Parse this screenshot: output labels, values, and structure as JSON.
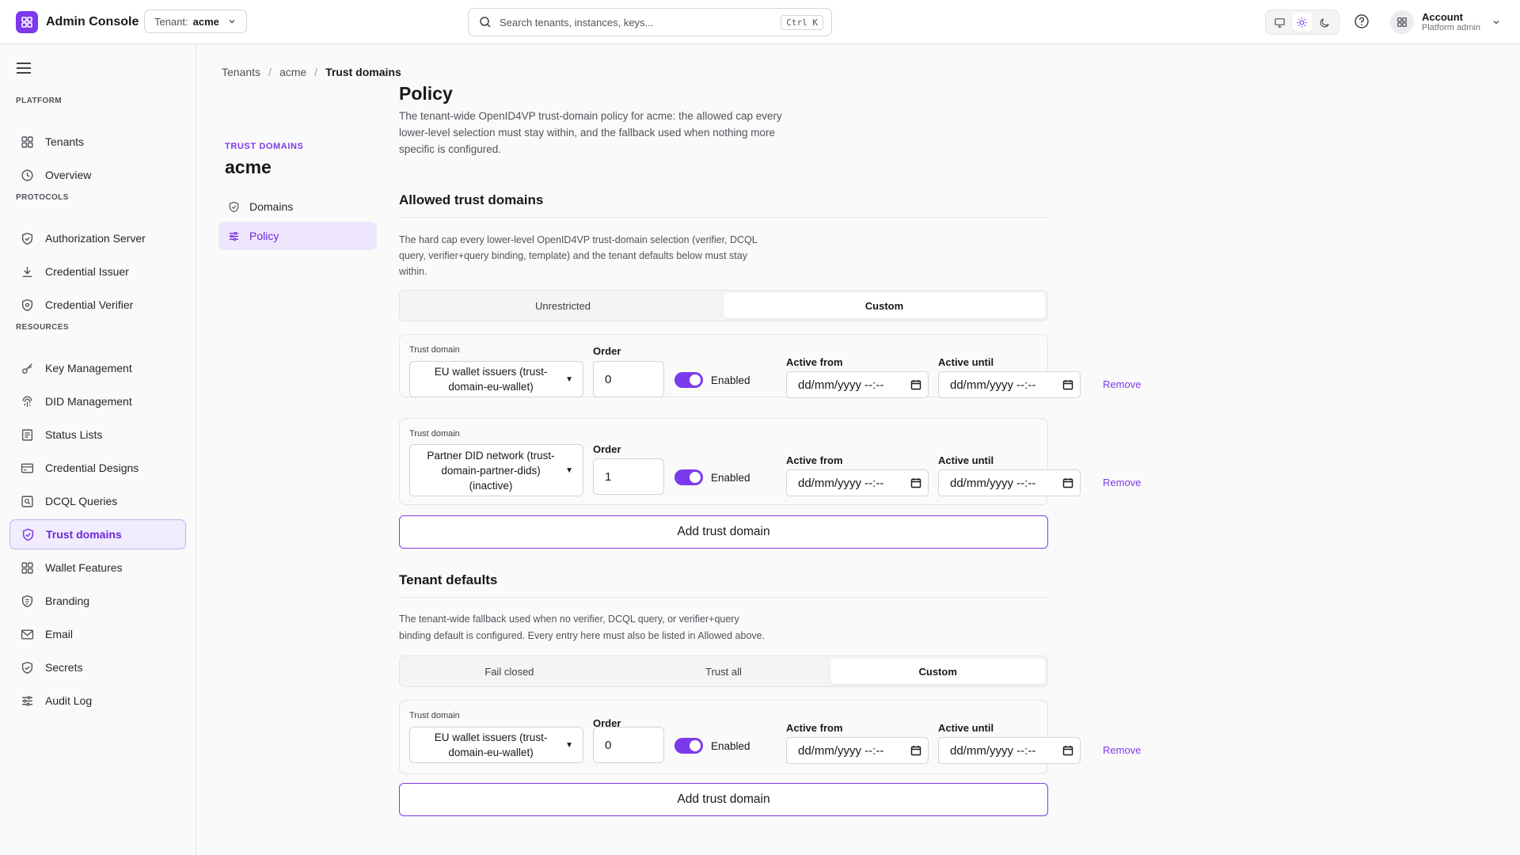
{
  "app": {
    "title": "Admin Console"
  },
  "tenant": {
    "label": "Tenant:",
    "value": "acme"
  },
  "search": {
    "placeholder": "Search tenants, instances, keys...",
    "shortcut": "Ctrl K"
  },
  "account": {
    "name": "Account",
    "role": "Platform admin"
  },
  "theme": {
    "selected": "light"
  },
  "sidebar": {
    "sections": [
      {
        "title": "PLATFORM",
        "items": [
          {
            "label": "Tenants",
            "icon": "grid-icon"
          },
          {
            "label": "Overview",
            "icon": "clock-icon"
          }
        ]
      },
      {
        "title": "PROTOCOLS",
        "items": [
          {
            "label": "Authorization Server",
            "icon": "shield-icon"
          },
          {
            "label": "Credential Issuer",
            "icon": "download-icon"
          },
          {
            "label": "Credential Verifier",
            "icon": "shield-check-icon"
          }
        ]
      },
      {
        "title": "RESOURCES",
        "items": [
          {
            "label": "Key Management",
            "icon": "key-icon"
          },
          {
            "label": "DID Management",
            "icon": "fingerprint-icon"
          },
          {
            "label": "Status Lists",
            "icon": "list-icon"
          },
          {
            "label": "Credential Designs",
            "icon": "card-icon"
          },
          {
            "label": "DCQL Queries",
            "icon": "query-icon"
          },
          {
            "label": "Trust domains",
            "icon": "shield-icon",
            "active": true
          },
          {
            "label": "Wallet Features",
            "icon": "grid-icon"
          },
          {
            "label": "Branding",
            "icon": "badge-icon"
          },
          {
            "label": "Email",
            "icon": "mail-icon"
          },
          {
            "label": "Secrets",
            "icon": "shield-icon"
          },
          {
            "label": "Audit Log",
            "icon": "sliders-icon"
          }
        ]
      }
    ]
  },
  "breadcrumb": [
    "Tenants",
    "acme",
    "Trust domains"
  ],
  "subnav": {
    "label": "TRUST DOMAINS",
    "title": "acme",
    "items": [
      {
        "label": "Domains",
        "icon": "shield-icon"
      },
      {
        "label": "Policy",
        "icon": "sliders-icon",
        "active": true
      }
    ]
  },
  "policy": {
    "title": "Policy",
    "description": [
      "The tenant-wide OpenID4VP trust-domain policy for acme: the allowed cap every",
      "lower-level selection must stay within, and the fallback used when nothing more",
      "specific is configured."
    ]
  },
  "allowed": {
    "title": "Allowed trust domains",
    "description": [
      "The hard cap every lower-level OpenID4VP trust-domain selection (verifier, DCQL",
      "query, verifier+query binding, template) and the tenant defaults below must stay",
      "within."
    ],
    "modes": [
      "Unrestricted",
      "Custom"
    ],
    "selected_mode": "Custom",
    "entries": [
      {
        "domain_lines": [
          "EU wallet issuers (trust-",
          "domain-eu-wallet)"
        ],
        "order": "0",
        "enabled": true
      },
      {
        "domain_lines": [
          "Partner DID network (trust-",
          "domain-partner-dids)",
          "(inactive)"
        ],
        "order": "1",
        "enabled": true
      }
    ],
    "add_label": "Add trust domain"
  },
  "defaults": {
    "title": "Tenant defaults",
    "description": [
      "The tenant-wide fallback used when no verifier, DCQL query, or verifier+query",
      "binding default is configured. Every entry here must also be listed in Allowed above."
    ],
    "modes": [
      "Fail closed",
      "Trust all",
      "Custom"
    ],
    "selected_mode": "Custom",
    "entries": [
      {
        "domain_lines": [
          "EU wallet issuers (trust-",
          "domain-eu-wallet)"
        ],
        "order": "0",
        "enabled": true
      }
    ],
    "add_label": "Add trust domain"
  },
  "labels": {
    "trust_domain": "Trust domain",
    "order": "Order",
    "enabled": "Enabled",
    "active_from": "Active from",
    "active_until": "Active until",
    "date_placeholder": "dd/mm/yyyy --:--",
    "remove": "Remove"
  },
  "colors": {
    "accent": "#7c3aed",
    "accent_bg": "#f1ecfe",
    "border": "#e4e4e7"
  }
}
